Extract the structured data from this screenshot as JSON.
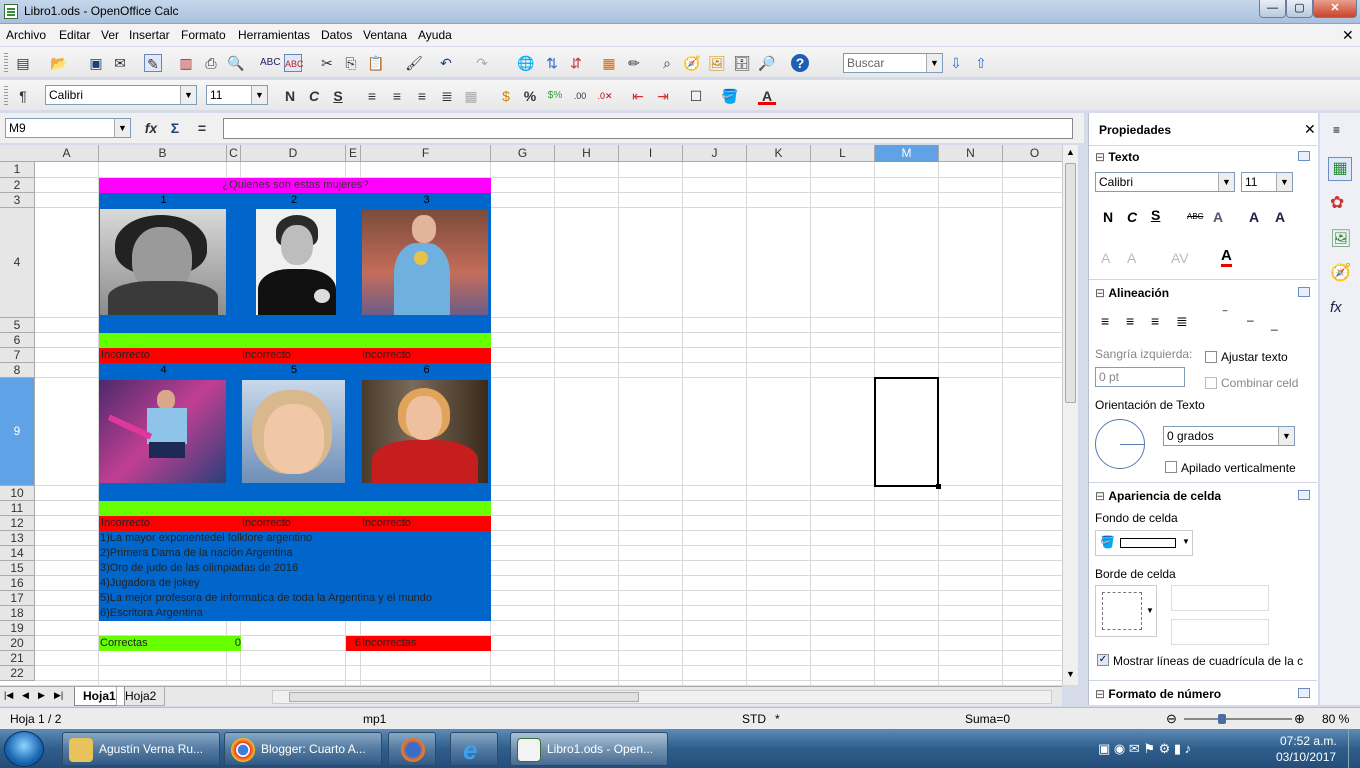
{
  "window": {
    "title": "Libro1.ods - OpenOffice Calc",
    "minimize": "—",
    "maximize": "▢",
    "close": "✕"
  },
  "menu": [
    "Archivo",
    "Editar",
    "Ver",
    "Insertar",
    "Formato",
    "Herramientas",
    "Datos",
    "Ventana",
    "Ayuda"
  ],
  "toolbar": {
    "search_placeholder": "Buscar",
    "font_name": "Calibri",
    "font_size": "11",
    "bold": "N",
    "italic": "C",
    "underline": "S"
  },
  "formula": {
    "name_box": "M9",
    "fx": "fx",
    "sum": "Σ",
    "eq": "=",
    "content": ""
  },
  "columns": [
    "A",
    "B",
    "C",
    "D",
    "E",
    "F",
    "G",
    "H",
    "I",
    "J",
    "K",
    "L",
    "M",
    "N",
    "O"
  ],
  "rows": [
    "1",
    "2",
    "3",
    "4",
    "5",
    "6",
    "7",
    "8",
    "9",
    "10",
    "11",
    "12",
    "13",
    "14",
    "15",
    "16",
    "17",
    "18",
    "19",
    "20",
    "21",
    "22"
  ],
  "cells": {
    "title": "¿Quienes son estas mujeres?",
    "n1": "1",
    "n2": "2",
    "n3": "3",
    "n4": "4",
    "n5": "5",
    "n6": "6",
    "incorrect": "Incorrecto",
    "clue1": "1)La mayor exponentedel folklore argentino",
    "clue2": "2)Primera Dama de la nación Argentina",
    "clue3": "3)Oro de judo de las olimpiadas de 2016",
    "clue4": "4)Jugadora de jokey",
    "clue5": "5)La mejor profesora de informatica de toda la Argentina y el mundo",
    "clue6": "6)Escritora Argentina",
    "correctas_label": "Correctas",
    "correctas_value": "0",
    "incorrectas_value": "6",
    "incorrectas_label": "Incorrectas"
  },
  "sheets": [
    "Hoja1",
    "Hoja2"
  ],
  "status": {
    "page": "Hoja 1 / 2",
    "style": "mp1",
    "mode": "STD",
    "modified": "*",
    "sum": "Suma=0",
    "zoom": "80 %"
  },
  "sidebar": {
    "title": "Propiedades",
    "texto": "Texto",
    "font": "Calibri",
    "size": "11",
    "alineacion": "Alineación",
    "sangria": "Sangría izquierda:",
    "sangria_val": "0 pt",
    "ajustar": "Ajustar texto",
    "combinar": "Combinar celd",
    "orientacion": "Orientación de Texto",
    "grados": "0 grados",
    "apilado": "Apilado verticalmente",
    "apariencia": "Apariencia de celda",
    "fondo": "Fondo de celda",
    "borde": "Borde de celda",
    "mostrar": "Mostrar líneas de cuadrícula de la c",
    "formato": "Formato de número"
  },
  "taskbar": {
    "items": [
      "Agustín Verna Ru...",
      "Blogger: Cuarto A...",
      "Libro1.ods - Open..."
    ],
    "time": "07:52 a.m.",
    "date": "03/10/2017"
  }
}
